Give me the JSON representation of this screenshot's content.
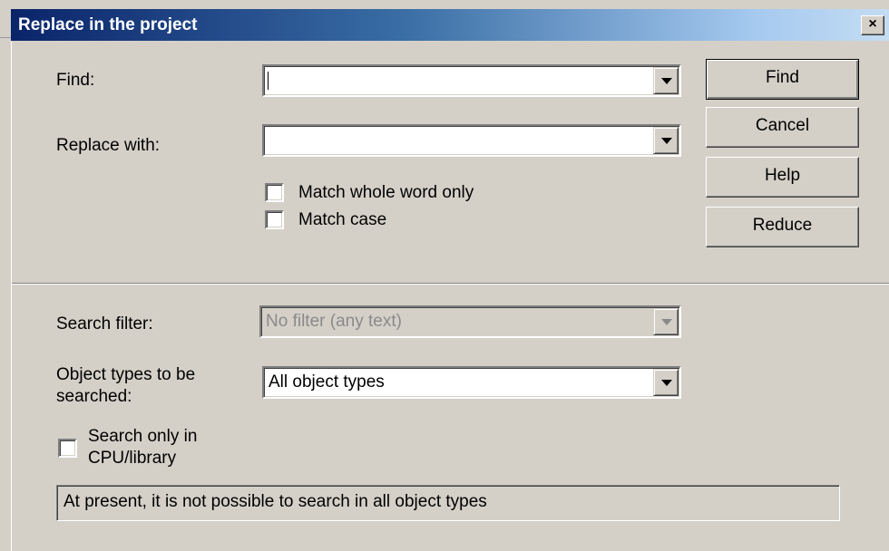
{
  "window": {
    "title": "Replace in the project",
    "close_glyph": "×"
  },
  "find": {
    "label": "Find:",
    "value": ""
  },
  "replace": {
    "label": "Replace with:",
    "value": ""
  },
  "options": {
    "whole_word": {
      "label": "Match whole word only",
      "checked": false
    },
    "match_case": {
      "label": "Match case",
      "checked": false
    }
  },
  "buttons": {
    "find": "Find",
    "cancel": "Cancel",
    "help": "Help",
    "reduce": "Reduce"
  },
  "search_filter": {
    "label": "Search filter:",
    "value": "No filter (any text)",
    "enabled": false
  },
  "object_types": {
    "label_line1": "Object types to be",
    "label_line2": "searched:",
    "value": "All object types"
  },
  "cpu_only": {
    "label_line1": "Search only in",
    "label_line2": "CPU/library",
    "checked": false
  },
  "status": {
    "message": "At present, it is not possible to search in all object types"
  },
  "colors": {
    "dialog_bg": "#d4d0c8",
    "title_start": "#0a246a",
    "title_end": "#a6caf0",
    "disabled_text": "#8a8a8a"
  }
}
